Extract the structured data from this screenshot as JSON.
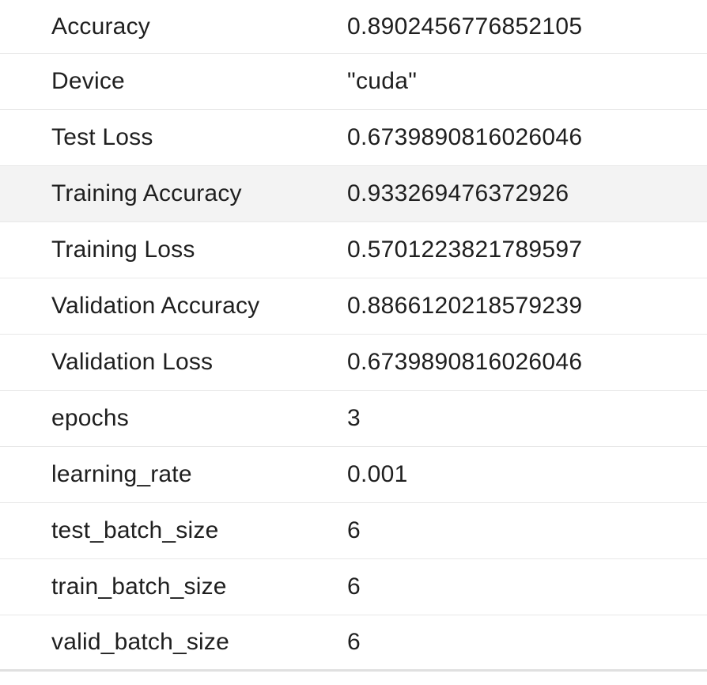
{
  "rows": [
    {
      "name": "Accuracy",
      "value": "0.8902456776852105"
    },
    {
      "name": "Device",
      "value": "\"cuda\""
    },
    {
      "name": "Test Loss",
      "value": "0.6739890816026046"
    },
    {
      "name": "Training Accuracy",
      "value": "0.933269476372926"
    },
    {
      "name": "Training Loss",
      "value": "0.5701223821789597"
    },
    {
      "name": "Validation Accuracy",
      "value": "0.8866120218579239"
    },
    {
      "name": "Validation Loss",
      "value": "0.6739890816026046"
    },
    {
      "name": "epochs",
      "value": "3"
    },
    {
      "name": "learning_rate",
      "value": "0.001"
    },
    {
      "name": "test_batch_size",
      "value": "6"
    },
    {
      "name": "train_batch_size",
      "value": "6"
    },
    {
      "name": "valid_batch_size",
      "value": "6"
    }
  ],
  "highlighted_row": "Training Accuracy"
}
